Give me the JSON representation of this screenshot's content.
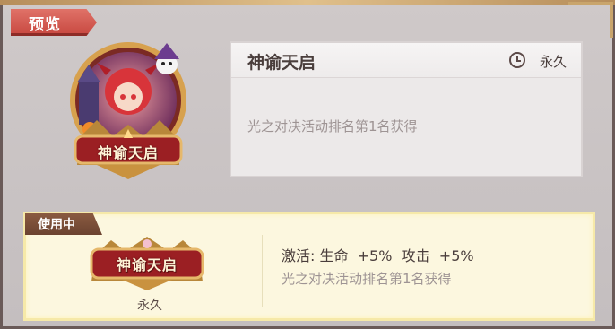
{
  "tab": {
    "label": "预览"
  },
  "emblem": {
    "name": "神谕天启"
  },
  "card": {
    "title": "神谕天启",
    "duration": "永久",
    "description": "光之对决活动排名第1名获得"
  },
  "active": {
    "tag": "使用中",
    "emblem_name": "神谕天启",
    "duration": "永久",
    "activation": "激活: 生命  +5%  攻击  +5%",
    "source": "光之对决活动排名第1名获得"
  },
  "icons": {
    "clock": "clock-icon"
  }
}
